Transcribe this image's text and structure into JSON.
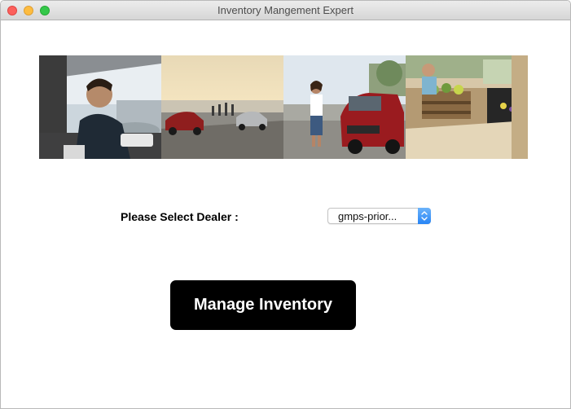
{
  "window": {
    "title": "Inventory Mangement Expert"
  },
  "banner": {
    "panels": [
      {
        "icon": "photo-driver-in-car"
      },
      {
        "icon": "photo-cars-on-coast-road"
      },
      {
        "icon": "photo-woman-with-red-car"
      },
      {
        "icon": "photo-cargo-trunk"
      }
    ]
  },
  "dealer": {
    "label": "Please Select Dealer :",
    "selected": "gmps-prior..."
  },
  "actions": {
    "manage_label": "Manage Inventory"
  },
  "colors": {
    "button_bg": "#000000",
    "button_text": "#ffffff",
    "select_accent": "#2784f5"
  }
}
